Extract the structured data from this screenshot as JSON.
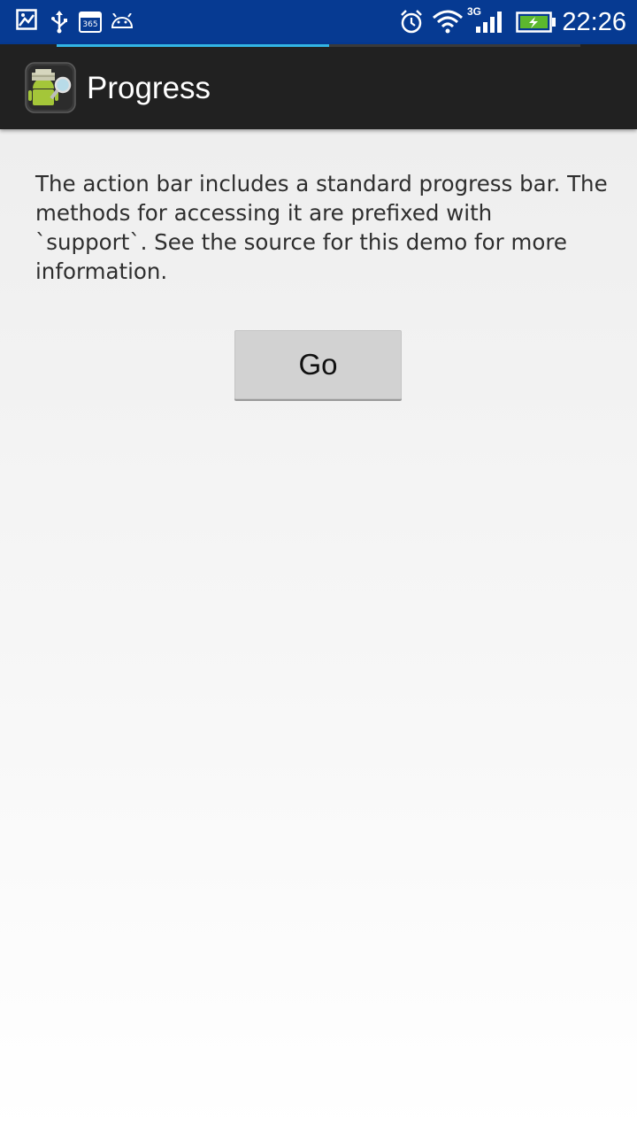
{
  "status_bar": {
    "time": "22:26",
    "network_type": "3G",
    "calendar_badge": "365",
    "icons": [
      "image-icon",
      "usb-icon",
      "calendar-365-icon",
      "android-debug-icon",
      "alarm-icon",
      "wifi-icon",
      "signal-icon",
      "battery-charging-icon"
    ],
    "background_color": "#063a92"
  },
  "action_bar": {
    "title": "Progress",
    "progress_fraction": 0.52,
    "progress_color": "#33b5e5",
    "background_color": "#212121"
  },
  "content": {
    "description": "The action bar includes a standard progress bar. The methods for accessing it are prefixed with `support`. See the source for this demo for more information.",
    "go_button_label": "Go"
  }
}
